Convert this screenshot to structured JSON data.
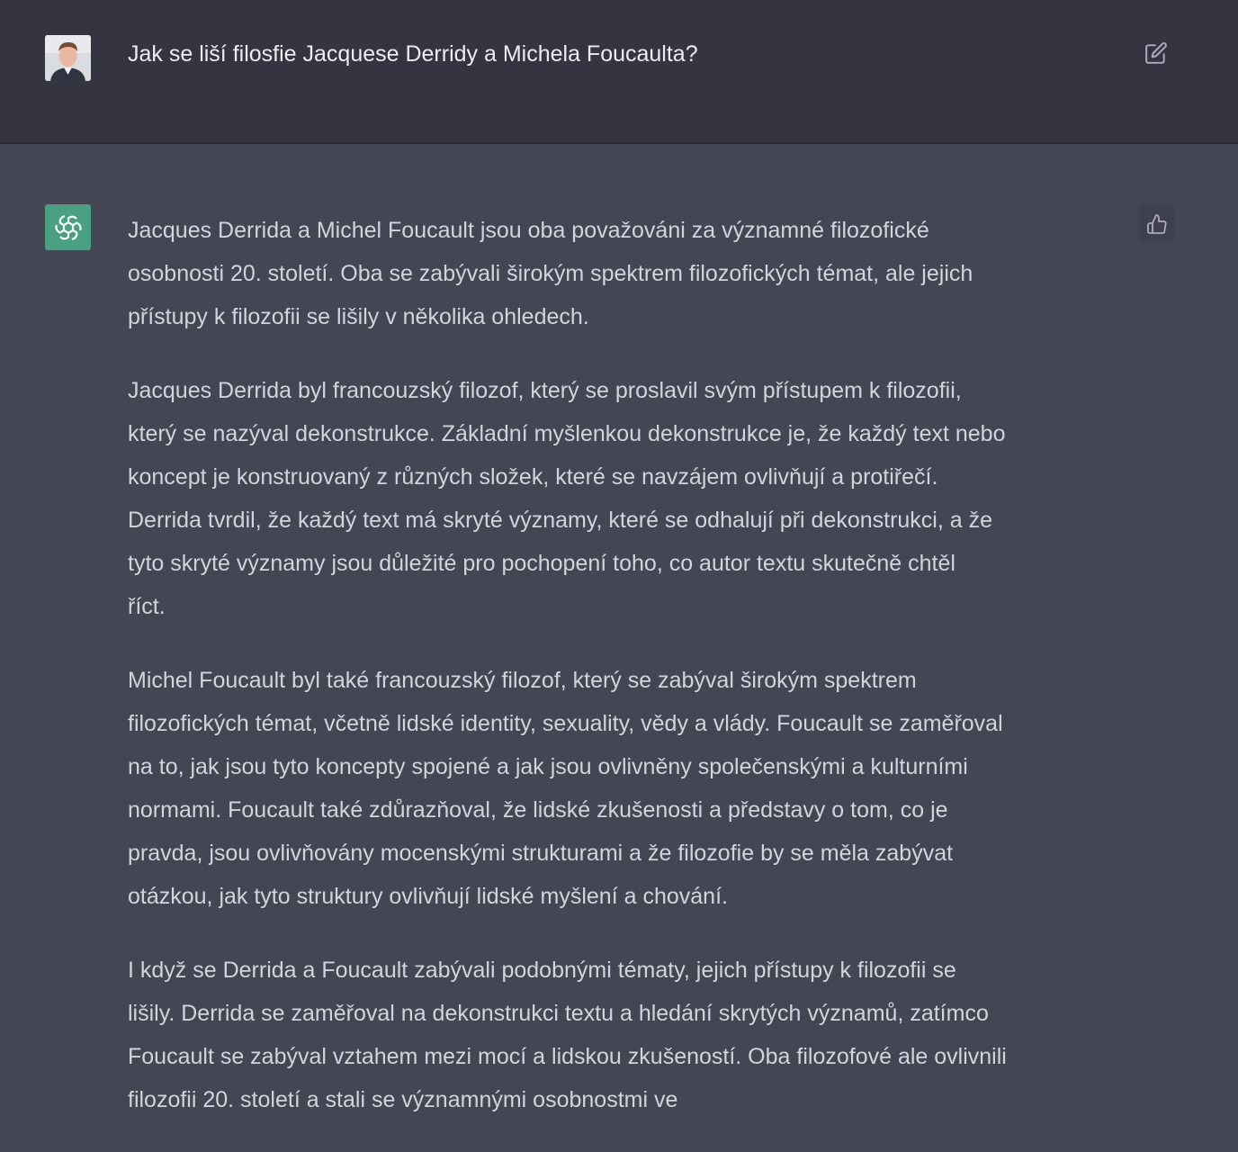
{
  "user_message": {
    "text": "Jak se liší filosfie Jacquese Derridy a Michela Foucaulta?",
    "avatar_icon": "user-photo-avatar",
    "edit_icon": "edit-icon"
  },
  "assistant_message": {
    "avatar_icon": "openai-logo-icon",
    "feedback_icon": "thumbs-up-icon",
    "paragraphs": [
      {
        "lines": [
          "Jacques Derrida a Michel Foucault jsou oba považováni za významné filozofické",
          "osobnosti 20. století. Oba se zabývali širokým spektrem filozofických témat, ale jejich",
          "přístupy k filozofii se lišily v několika ohledech."
        ]
      },
      {
        "lines": [
          "Jacques Derrida byl francouzský filozof, který se proslavil svým přístupem k filozofii,",
          "který se nazýval dekonstrukce. Základní myšlenkou dekonstrukce je, že každý text nebo",
          "koncept je konstruovaný z různých složek, které se navzájem ovlivňují a protiřečí.",
          "Derrida tvrdil, že každý text má skryté významy, které se odhalují při dekonstrukci, a že",
          "tyto skryté významy jsou důležité pro pochopení toho, co autor textu skutečně chtěl",
          "říct."
        ]
      },
      {
        "lines": [
          "Michel Foucault byl také francouzský filozof, který se zabýval širokým spektrem",
          "filozofických témat, včetně lidské identity, sexuality, vědy a vlády. Foucault se zaměřoval",
          "na to, jak jsou tyto koncepty spojené a jak jsou ovlivněny společenskými a kulturními",
          "normami. Foucault také zdůrazňoval, že lidské zkušenosti a představy o tom, co je",
          "pravda, jsou ovlivňovány mocenskými strukturami a že filozofie by se měla zabývat",
          "otázkou, jak tyto struktury ovlivňují lidské myšlení a chování."
        ]
      },
      {
        "lines": [
          "I když se Derrida a Foucault zabývali podobnými tématy, jejich přístupy k filozofii se",
          "lišily. Derrida se zaměřoval na dekonstrukci textu a hledání skrytých významů, zatímco",
          "Foucault se zabýval vztahem mezi mocí a lidskou zkušeností. Oba filozofové ale ovlivnili",
          "filozofii 20. století a stali se významnými osobnostmi ve"
        ]
      }
    ]
  },
  "colors": {
    "user_row_bg": "#343541",
    "assistant_row_bg": "#444654",
    "bot_avatar_bg": "#4aa181",
    "text": "#d1d5db"
  }
}
